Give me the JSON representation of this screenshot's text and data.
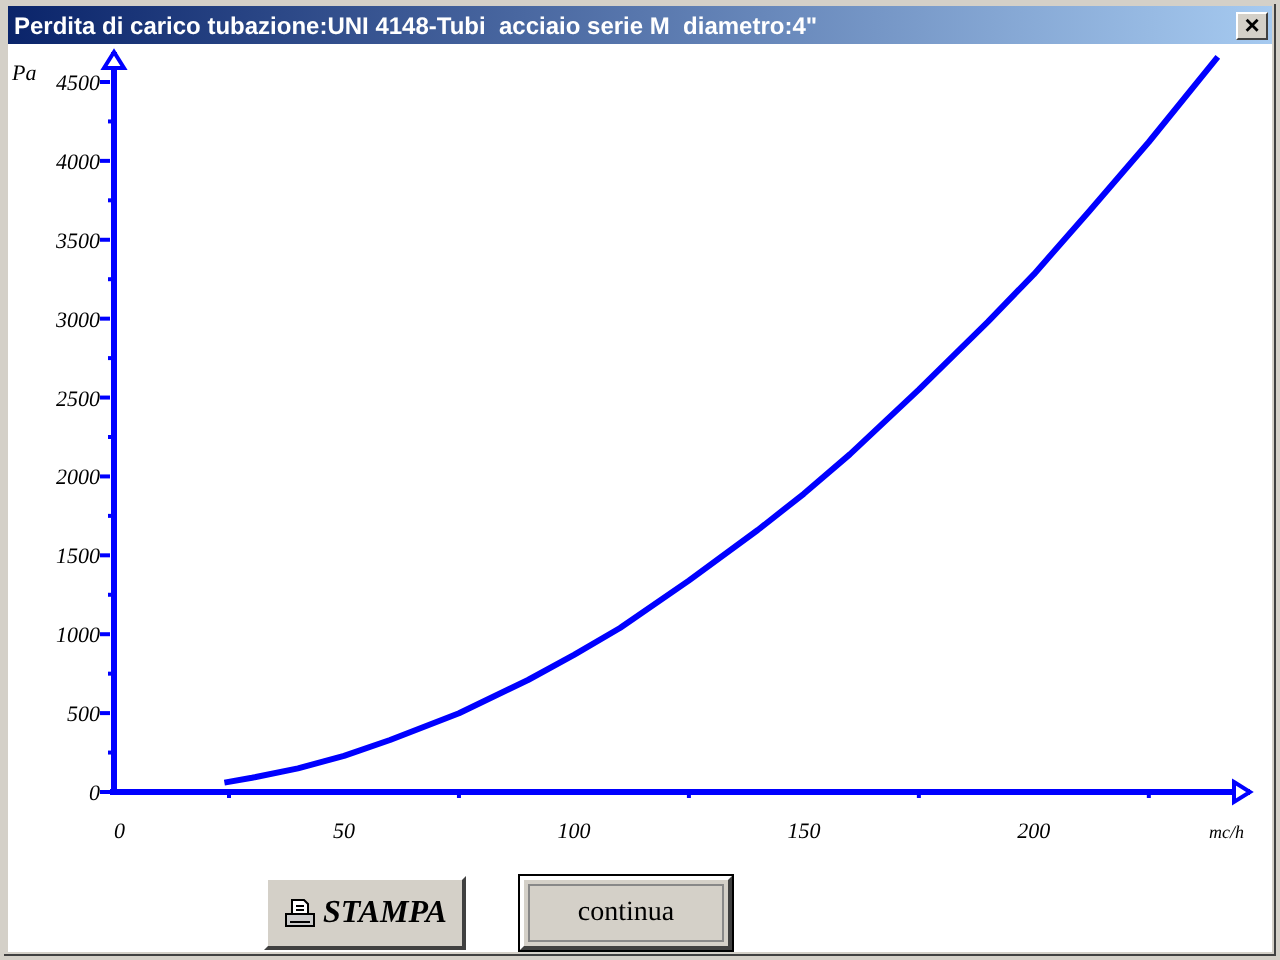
{
  "window": {
    "title": "Perdita di carico tubazione:UNI 4148-Tubi  acciaio serie M  diametro:4\"",
    "close": "×"
  },
  "chart": {
    "chart_data": {
      "type": "line",
      "xlabel": "mc/h",
      "ylabel": "Pa",
      "xlim": [
        0,
        247
      ],
      "ylim": [
        0,
        4690
      ],
      "xticks": [
        0,
        50,
        100,
        150,
        200
      ],
      "yticks": [
        0,
        500,
        1000,
        1500,
        2000,
        2500,
        3000,
        3500,
        4000,
        4500
      ],
      "x": [
        24,
        30,
        40,
        50,
        60,
        75,
        90,
        100,
        110,
        125,
        140,
        150,
        160,
        175,
        190,
        200,
        212,
        225,
        240
      ],
      "series": [
        {
          "color": "#0000ff",
          "values": [
            60,
            90,
            150,
            230,
            330,
            500,
            710,
            870,
            1040,
            1340,
            1660,
            1890,
            2140,
            2550,
            2980,
            3280,
            3680,
            4120,
            4660
          ]
        }
      ]
    }
  },
  "buttons": [
    {
      "kind": "print",
      "label": "STAMPA"
    },
    {
      "kind": "default",
      "label": "continua"
    }
  ]
}
